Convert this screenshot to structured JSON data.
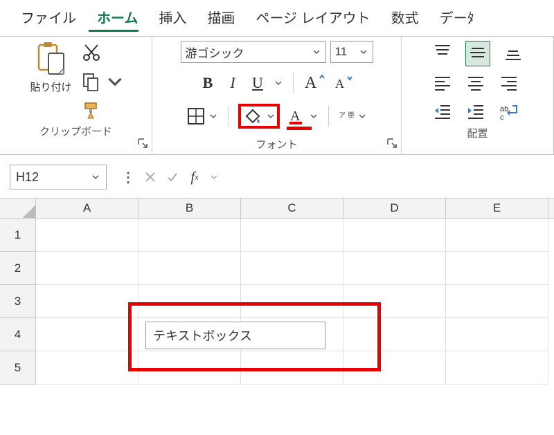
{
  "tabs": {
    "file": "ファイル",
    "home": "ホーム",
    "insert": "挿入",
    "draw": "描画",
    "layout": "ページ レイアウト",
    "formulas": "数式",
    "data": "デーﾀ"
  },
  "ribbon": {
    "clipboard": {
      "paste": "貼り付け",
      "label": "クリップボード"
    },
    "font": {
      "name": "游ゴシック",
      "size": "11",
      "bold": "B",
      "italic": "I",
      "underline": "U",
      "ruby": "ア\n亜",
      "label": "フォント"
    },
    "align": {
      "label": "配置"
    }
  },
  "namebox": "H12",
  "textbox": "テキストボックス",
  "columns": [
    "A",
    "B",
    "C",
    "D",
    "E"
  ],
  "rows": [
    "1",
    "2",
    "3",
    "4",
    "5"
  ]
}
